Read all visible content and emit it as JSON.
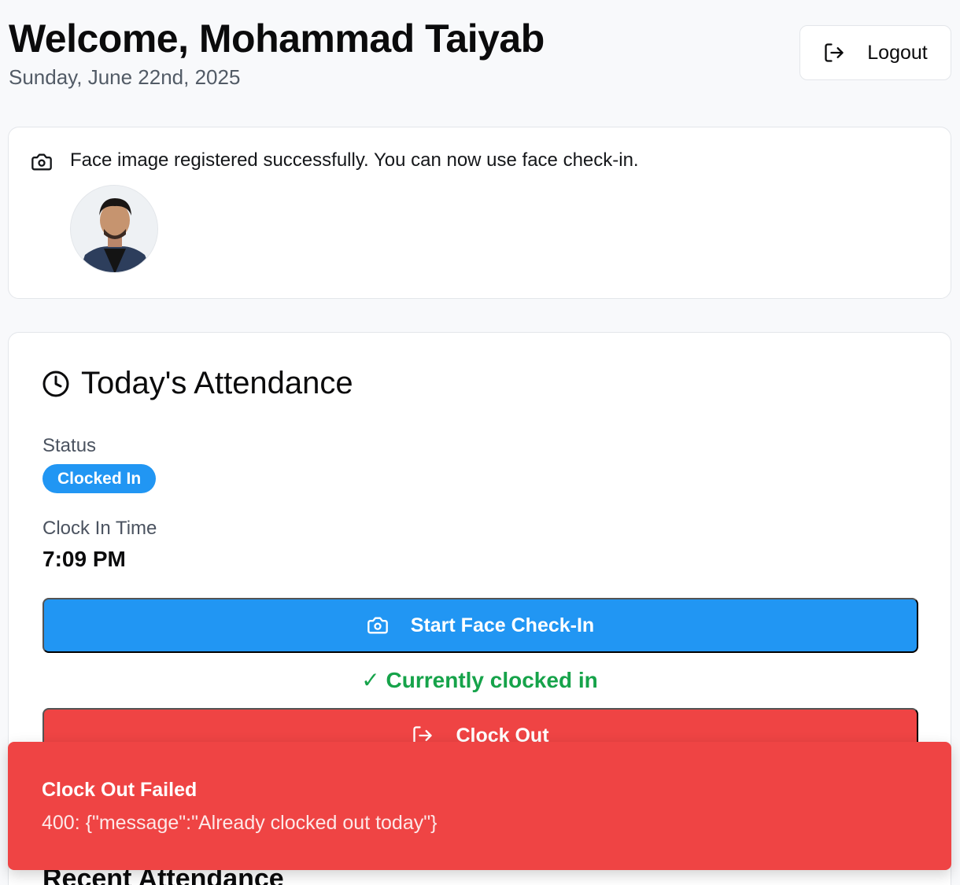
{
  "header": {
    "title": "Welcome, Mohammad Taiyab",
    "date": "Sunday, June 22nd, 2025",
    "logout_label": "Logout"
  },
  "face_registration": {
    "message": "Face image registered successfully. You can now use face check-in.",
    "icon": "camera-icon"
  },
  "attendance": {
    "title": "Today's Attendance",
    "icon": "clock-icon",
    "status_label": "Status",
    "status_value": "Clocked In",
    "clock_in_label": "Clock In Time",
    "clock_in_value": "7:09 PM",
    "face_checkin_label": "Start Face Check-In",
    "clocked_in_message": "✓ Currently clocked in",
    "clock_out_label": "Clock Out"
  },
  "recent": {
    "title": "Recent Attendance"
  },
  "toast": {
    "title": "Clock Out Failed",
    "description": "400: {\"message\":\"Already clocked out today\"}"
  },
  "colors": {
    "primary": "#2196f3",
    "danger": "#ef4444",
    "success": "#16a34a"
  }
}
